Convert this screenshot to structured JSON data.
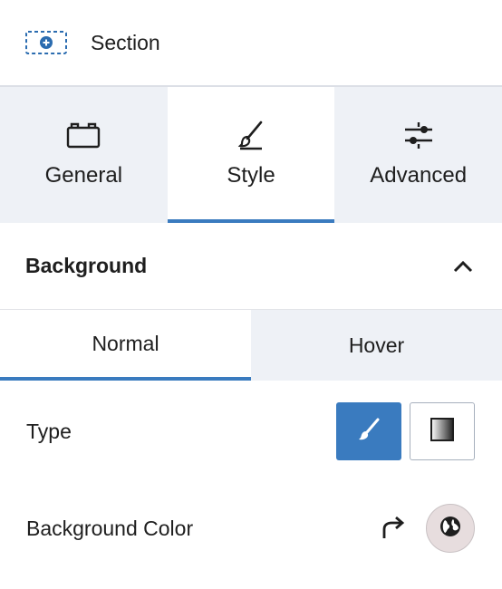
{
  "header": {
    "title": "Section",
    "icon": "section-add-icon"
  },
  "tabs": [
    {
      "label": "General",
      "icon": "layout-icon",
      "active": false
    },
    {
      "label": "Style",
      "icon": "brush-icon",
      "active": true
    },
    {
      "label": "Advanced",
      "icon": "sliders-icon",
      "active": false
    }
  ],
  "background": {
    "title": "Background",
    "expanded": true,
    "states": [
      {
        "label": "Normal",
        "active": true
      },
      {
        "label": "Hover",
        "active": false
      }
    ],
    "type": {
      "label": "Type",
      "options": [
        {
          "icon": "paint-brush-icon",
          "selected": true
        },
        {
          "icon": "gradient-icon",
          "selected": false
        }
      ]
    },
    "color": {
      "label": "Background Color",
      "reset_icon": "reset-icon",
      "picker_icon": "globe-icon"
    }
  },
  "colors": {
    "accent": "#3a7bbf",
    "tab_bg": "#eef1f6",
    "swatch": "#e7ddde"
  }
}
